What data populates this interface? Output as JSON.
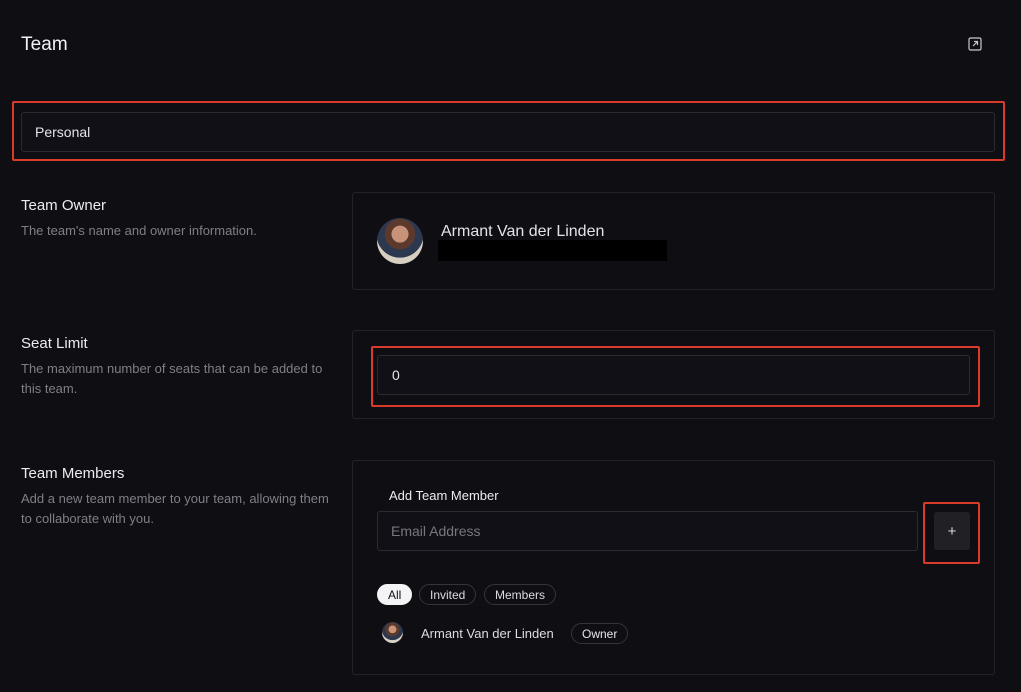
{
  "header": {
    "title": "Team",
    "open_icon": "open-external-icon"
  },
  "team_selector": {
    "value": "Personal"
  },
  "owner_section": {
    "title": "Team Owner",
    "description": "The team's name and owner information.",
    "owner_name": "Armant Van der Linden"
  },
  "seat_section": {
    "title": "Seat Limit",
    "description": "The maximum number of seats that can be added to this team.",
    "value": "0"
  },
  "members_section": {
    "title": "Team Members",
    "description": "Add a new team member to your team, allowing them to collaborate with you.",
    "add_label": "Add Team Member",
    "email_placeholder": "Email Address",
    "add_button": "+",
    "filters": [
      "All",
      "Invited",
      "Members"
    ],
    "members": [
      {
        "name": "Armant Van der Linden",
        "role": "Owner"
      }
    ]
  },
  "colors": {
    "background": "#0f0e13",
    "highlight": "#d93a2a",
    "active_pill": "#f4f4f6"
  }
}
